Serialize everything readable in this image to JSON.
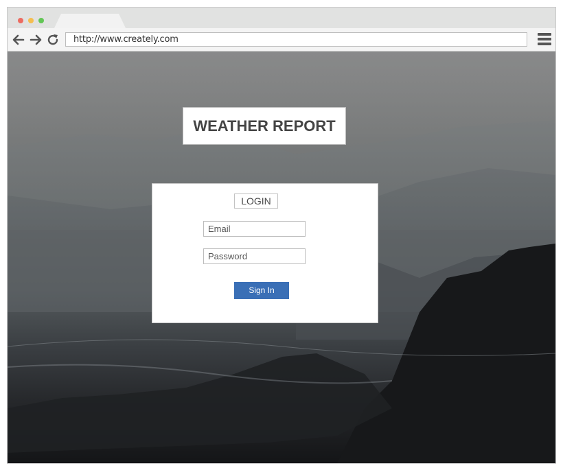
{
  "browser": {
    "url": "http://www.creately.com",
    "nav_icons": [
      "back-arrow-icon",
      "forward-arrow-icon",
      "refresh-icon"
    ],
    "menu_icon": "hamburger-menu-icon",
    "window_dots": [
      "#ed6b60",
      "#f5be4f",
      "#62c655"
    ]
  },
  "page": {
    "title": "WEATHER REPORT",
    "login": {
      "heading": "LOGIN",
      "email_placeholder": "Email",
      "password_placeholder": "Password",
      "submit_label": "Sign In"
    },
    "accent_color": "#3a6fb6"
  }
}
